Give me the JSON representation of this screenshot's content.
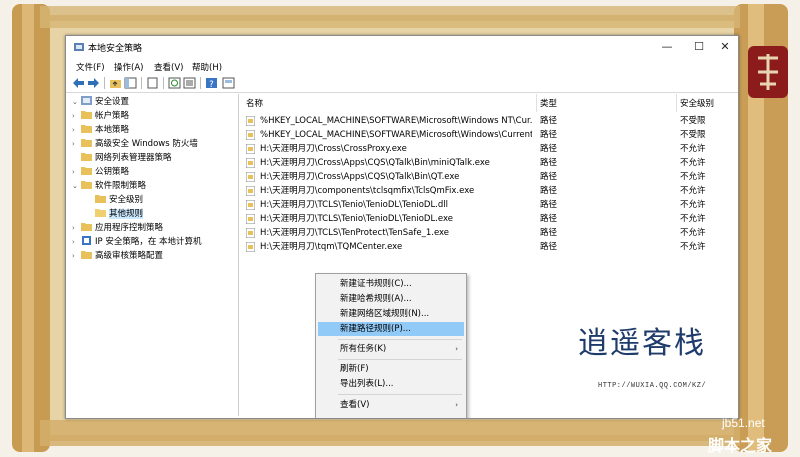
{
  "window": {
    "title": "本地安全策略",
    "controls": {
      "minimize": "—",
      "maximize": "☐",
      "close": "✕"
    }
  },
  "menu": [
    "文件(F)",
    "操作(A)",
    "查看(V)",
    "帮助(H)"
  ],
  "tree": [
    {
      "label": "安全设置",
      "level": 0,
      "arrow": "⌄",
      "icon": "settings-icon"
    },
    {
      "label": "帐户策略",
      "level": 1,
      "arrow": "›",
      "icon": "folder-icon"
    },
    {
      "label": "本地策略",
      "level": 1,
      "arrow": "›",
      "icon": "folder-icon"
    },
    {
      "label": "高级安全 Windows 防火墙",
      "level": 1,
      "arrow": "›",
      "icon": "folder-icon"
    },
    {
      "label": "网络列表管理器策略",
      "level": 1,
      "arrow": "",
      "icon": "folder-icon"
    },
    {
      "label": "公钥策略",
      "level": 1,
      "arrow": "›",
      "icon": "folder-icon"
    },
    {
      "label": "软件限制策略",
      "level": 1,
      "arrow": "⌄",
      "icon": "folder-icon"
    },
    {
      "label": "安全级别",
      "level": 2,
      "arrow": "",
      "icon": "folder-icon"
    },
    {
      "label": "其他规则",
      "level": 2,
      "arrow": "",
      "icon": "folder-icon",
      "selected": true
    },
    {
      "label": "应用程序控制策略",
      "level": 1,
      "arrow": "›",
      "icon": "folder-icon"
    },
    {
      "label": "IP 安全策略，在 本地计算机",
      "level": 1,
      "arrow": "›",
      "icon": "ip-icon"
    },
    {
      "label": "高级审核策略配置",
      "level": 1,
      "arrow": "›",
      "icon": "folder-icon"
    }
  ],
  "list": {
    "headers": [
      "名称",
      "类型",
      "安全级别"
    ],
    "rows": [
      [
        "%HKEY_LOCAL_MACHINE\\SOFTWARE\\Microsoft\\Windows NT\\Cur...",
        "路径",
        "不受限"
      ],
      [
        "%HKEY_LOCAL_MACHINE\\SOFTWARE\\Microsoft\\Windows\\Current...",
        "路径",
        "不受限"
      ],
      [
        "H:\\天涯明月刀\\Cross\\CrossProxy.exe",
        "路径",
        "不允许"
      ],
      [
        "H:\\天涯明月刀\\Cross\\Apps\\CQS\\QTalk\\Bin\\miniQTalk.exe",
        "路径",
        "不允许"
      ],
      [
        "H:\\天涯明月刀\\Cross\\Apps\\CQS\\QTalk\\Bin\\QT.exe",
        "路径",
        "不允许"
      ],
      [
        "H:\\天涯明月刀\\components\\tclsqmfix\\TclsQmFix.exe",
        "路径",
        "不允许"
      ],
      [
        "H:\\天涯明月刀\\TCLS\\Tenio\\TenioDL\\TenioDL.dll",
        "路径",
        "不允许"
      ],
      [
        "H:\\天涯明月刀\\TCLS\\Tenio\\TenioDL\\TenioDL.exe",
        "路径",
        "不允许"
      ],
      [
        "H:\\天涯明月刀\\TCLS\\TenProtect\\TenSafe_1.exe",
        "路径",
        "不允许"
      ],
      [
        "H:\\天涯明月刀\\tqm\\TQMCenter.exe",
        "路径",
        "不允许"
      ]
    ]
  },
  "context_menu": [
    {
      "label": "新建证书规则(C)...",
      "name": "ctx-new-cert-rule"
    },
    {
      "label": "新建哈希规则(A)...",
      "name": "ctx-new-hash-rule"
    },
    {
      "label": "新建网络区域规则(N)...",
      "name": "ctx-new-zone-rule"
    },
    {
      "label": "新建路径规则(P)...",
      "name": "ctx-new-path-rule",
      "highlighted": true
    },
    {
      "sep": true
    },
    {
      "label": "所有任务(K)",
      "name": "ctx-all-tasks",
      "submenu": "›"
    },
    {
      "sep": true
    },
    {
      "label": "刷新(F)",
      "name": "ctx-refresh"
    },
    {
      "label": "导出列表(L)...",
      "name": "ctx-export-list"
    },
    {
      "sep": true
    },
    {
      "label": "查看(V)",
      "name": "ctx-view",
      "submenu": "›"
    }
  ],
  "watermark": {
    "logo": "逍遥客栈",
    "url": "HTTP://WUXIA.QQ.COM/KZ/",
    "site": "jb51.net",
    "site_cn": "脚本之家"
  },
  "colors": {
    "selection": "#cce8ff",
    "menu_highlight": "#91c9f7",
    "logo": "#1e3b6b"
  }
}
